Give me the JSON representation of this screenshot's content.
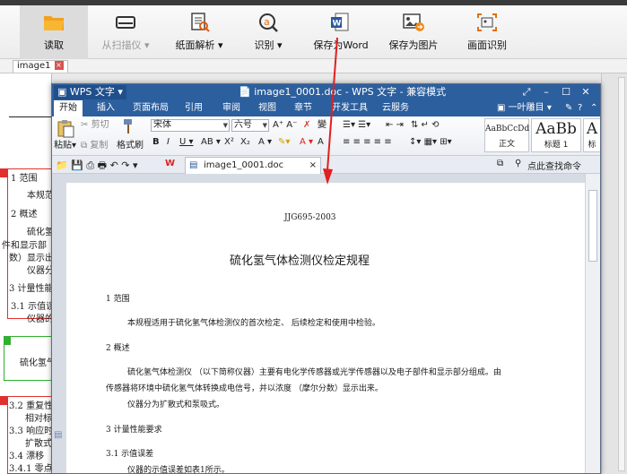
{
  "toolbar": {
    "items": [
      {
        "label": "读取",
        "active": true
      },
      {
        "label": "从扫描仪 ▾",
        "disabled": true
      },
      {
        "label": "纸面解析 ▾"
      },
      {
        "label": "识别 ▾"
      },
      {
        "label": "保存为Word"
      },
      {
        "label": "保存为图片"
      },
      {
        "label": "画面识别"
      }
    ]
  },
  "image_tab": {
    "label": "image1"
  },
  "original": {
    "lines": [
      "1 范围",
      "本规范",
      "2 概述",
      "硫化氢",
      "件和显示部",
      "数）显示出",
      "仪器分",
      "3 计量性能",
      "3.1 示值误",
      "仪器的",
      "硫化氢气",
      "3.2 重复性",
      "相对标",
      "3.3 响应时",
      "扩散式",
      "3.4 漂移",
      "3.4.1 零点"
    ]
  },
  "wps": {
    "app_name": "WPS 文字",
    "title": "image1_0001.doc - WPS 文字 - 兼容模式",
    "menu": [
      "开始",
      "插入",
      "页面布局",
      "引用",
      "审阅",
      "视图",
      "章节",
      "开发工具",
      "云服务"
    ],
    "right_menu": "一叶雕目",
    "ribbon": {
      "paste": "粘贴",
      "cut": "剪切",
      "copy": "复制",
      "format_painter": "格式刷",
      "font_name": "宋体",
      "font_size": "六号",
      "styles": [
        {
          "sample": "AaBbCcDd",
          "name": "正文"
        },
        {
          "sample": "AaBb",
          "name": "标题 1"
        },
        {
          "sample": "A",
          "name": "标"
        }
      ]
    },
    "doc_tab": "image1_0001.doc",
    "search_label": "点此查找命令",
    "document": {
      "header_code": "JJG695-2003",
      "title": "硫化氢气体检测仪检定规程",
      "lines": [
        "1  范围",
        "本规程适用于硫化氢气体检测仪的首次检定、 后续检定和使用中检验。",
        "2  概述",
        "硫化氢气体检测仪 （以下简称仪器）主要有电化学传感器或光学传感器以及电子部件和显示部分组成。由",
        "传感器将环境中硫化氢气体转换成电信号，并以浓度 （摩尔分数）显示出来。",
        "仪器分为扩散式和泵吸式。",
        "3  计量性能要求",
        "3.1  示值误差",
        "仪器的示值误差如表1所示。"
      ]
    }
  },
  "colors": {
    "wps_blue": "#2c5f9e",
    "arrow_red": "#e02020",
    "box_red": "#e03030",
    "box_green": "#31b031"
  }
}
